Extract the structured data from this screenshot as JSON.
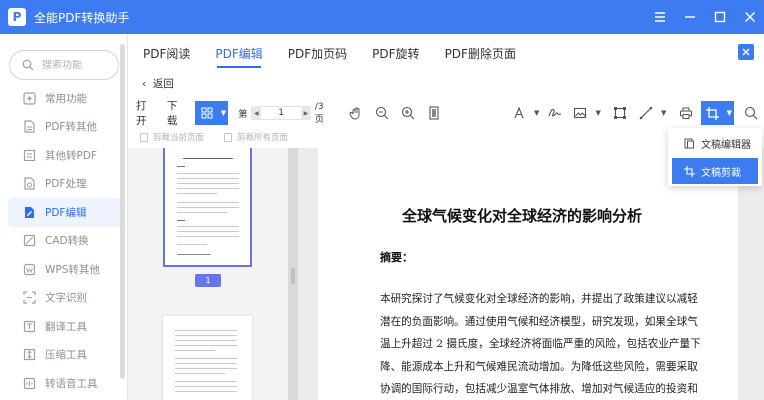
{
  "app": {
    "title": "全能PDF转换助手",
    "logo": "P"
  },
  "search": {
    "placeholder": "搜索功能"
  },
  "sidebar": {
    "items": [
      {
        "label": "常用功能",
        "icon": "frequent-icon"
      },
      {
        "label": "PDF转其他",
        "icon": "pdf-convert-icon"
      },
      {
        "label": "其他转PDF",
        "icon": "to-pdf-icon"
      },
      {
        "label": "PDF处理",
        "icon": "pdf-process-icon"
      },
      {
        "label": "PDF编辑",
        "icon": "pdf-edit-icon",
        "active": true
      },
      {
        "label": "CAD转换",
        "icon": "cad-icon"
      },
      {
        "label": "WPS转其他",
        "icon": "wps-icon"
      },
      {
        "label": "文字识别",
        "icon": "ocr-icon"
      },
      {
        "label": "翻译工具",
        "icon": "translate-icon"
      },
      {
        "label": "压缩工具",
        "icon": "compress-icon"
      },
      {
        "label": "转语音工具",
        "icon": "voice-icon"
      }
    ]
  },
  "tabs": [
    {
      "label": "PDF阅读"
    },
    {
      "label": "PDF编辑",
      "active": true
    },
    {
      "label": "PDF加页码"
    },
    {
      "label": "PDF旋转"
    },
    {
      "label": "PDF删除页面"
    }
  ],
  "back": {
    "label": "返回"
  },
  "toolbar": {
    "open": "打开",
    "download": "下载",
    "page_prefix": "第",
    "page_value": "1",
    "page_total": "/3 页"
  },
  "subbar": {
    "crop_current": "剪裁当前页面",
    "crop_all": "剪裁所有页面"
  },
  "thumbs": {
    "page_badge": "1"
  },
  "document": {
    "title": "全球气候变化对全球经济的影响分析",
    "abstract_label": "摘要：",
    "lines": [
      "本研究探讨了气候变化对全球经济的影响，并提出了政策建议以减轻",
      "潜在的负面影响。通过使用气候和经济模型，研究发现，如果全球气",
      "温上升超过 2 摄氏度，全球经济将面临严重的风险，包括农业产量下",
      "降、能源成本上升和气候难民流动增加。为降低这些风险，需要采取",
      "协调的国际行动，包括减少温室气体排放、增加对气候适应的投资和"
    ]
  },
  "dropdown": {
    "items": [
      {
        "label": "文稿编辑器",
        "icon": "editor-icon"
      },
      {
        "label": "文稿剪裁",
        "icon": "crop-icon",
        "active": true
      }
    ]
  },
  "colors": {
    "accent": "#3d7cf0",
    "active_thumb": "#6676e6"
  }
}
